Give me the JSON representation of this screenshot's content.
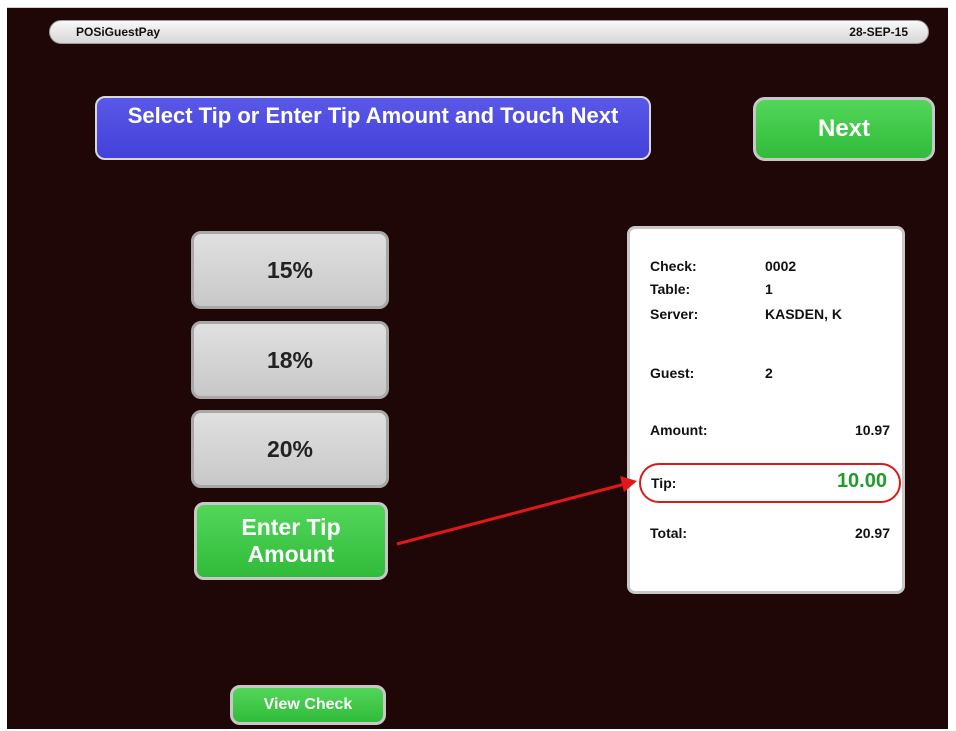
{
  "header": {
    "app_title": "POSiGuestPay",
    "date": "28-SEP-15"
  },
  "instruction": {
    "text": "Select Tip or Enter Tip Amount and Touch Next"
  },
  "buttons": {
    "next": "Next",
    "tip_15": "15%",
    "tip_18": "18%",
    "tip_20": "20%",
    "enter_tip": "Enter Tip Amount",
    "view_check": "View Check"
  },
  "check": {
    "check_label": "Check:",
    "check_value": "0002",
    "table_label": "Table:",
    "table_value": "1",
    "server_label": "Server:",
    "server_value": "KASDEN, K",
    "guest_label": "Guest:",
    "guest_value": "2",
    "amount_label": "Amount:",
    "amount_value": "10.97",
    "tip_label": "Tip:",
    "tip_value": "10.00",
    "total_label": "Total:",
    "total_value": "20.97"
  },
  "colors": {
    "background": "#1f0707",
    "instruction_blue": "#4a48e0",
    "button_green": "#3cc545",
    "tip_green": "#1e9c2c",
    "highlight_red": "#d81b1b"
  }
}
